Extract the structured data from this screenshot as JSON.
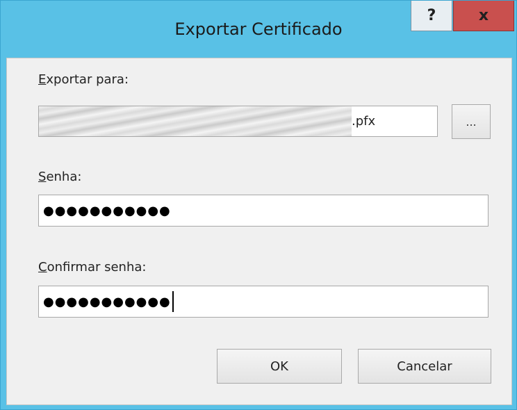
{
  "window": {
    "title": "Exportar Certificado",
    "help_glyph": "?",
    "close_glyph": "x"
  },
  "export": {
    "label_accel": "E",
    "label_rest": "xportar para:",
    "path_suffix": ".pfx",
    "browse_label": "..."
  },
  "password": {
    "label_accel": "S",
    "label_rest": "enha:",
    "masked_value": "●●●●●●●●●●●"
  },
  "confirm": {
    "label_accel": "C",
    "label_rest": "onfirmar senha:",
    "masked_value": "●●●●●●●●●●●"
  },
  "buttons": {
    "ok": "OK",
    "cancel": "Cancelar"
  },
  "colors": {
    "title_bar": "#59c1e6",
    "close_button": "#c9504e",
    "dialog_body": "#f0f0f0"
  }
}
